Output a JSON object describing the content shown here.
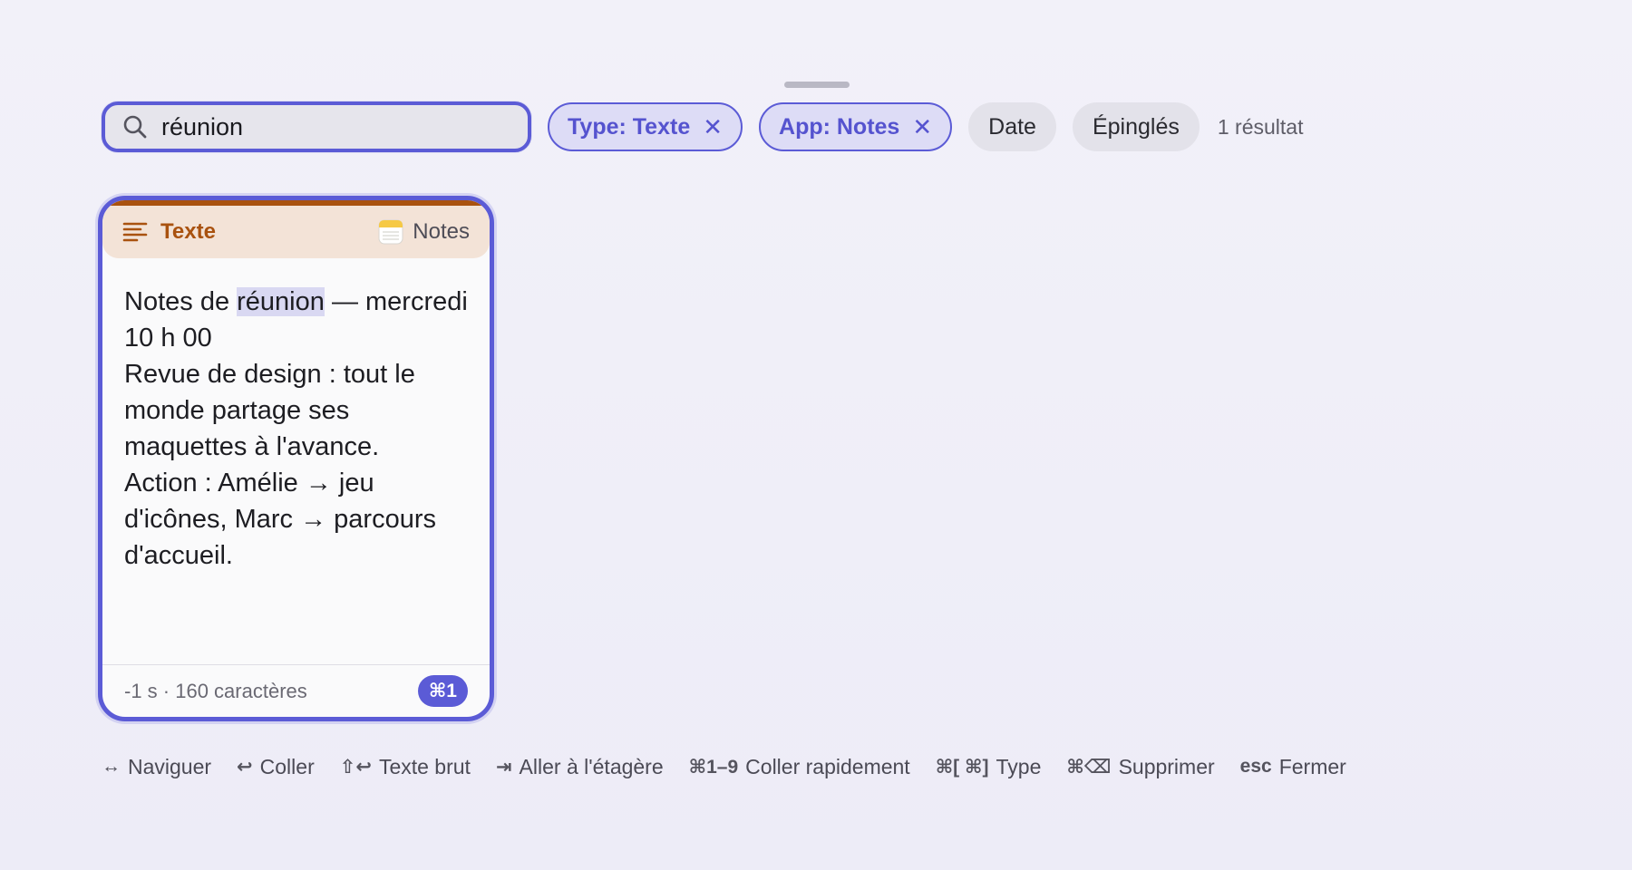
{
  "search": {
    "value": "réunion",
    "icon": "search-icon"
  },
  "filters": {
    "type_chip": "Type: Texte",
    "app_chip": "App: Notes",
    "date_chip": "Date",
    "pinned_chip": "Épinglés",
    "result_count": "1 résultat"
  },
  "card": {
    "type_label": "Texte",
    "app_label": "Notes",
    "body_prefix": "Notes de ",
    "body_match": "réunion",
    "body_rest": " — mercredi 10 h 00\nRevue de design : tout le monde partage ses maquettes à l'avance.\nAction : Amélie → jeu d'icônes, Marc → parcours d'accueil.",
    "meta": "-1 s · 160 caractères",
    "shortcut": "⌘1",
    "accent_color": "#a9520f"
  },
  "hints": [
    {
      "key": "↔",
      "label": "Naviguer"
    },
    {
      "key": "↩",
      "label": "Coller"
    },
    {
      "key": "⇧↩",
      "label": "Texte brut"
    },
    {
      "key": "⇥",
      "label": "Aller à l'étagère"
    },
    {
      "key": "⌘1–9",
      "label": "Coller rapidement"
    },
    {
      "key": "⌘[ ⌘]",
      "label": "Type"
    },
    {
      "key": "⌘⌫",
      "label": "Supprimer"
    },
    {
      "key": "esc",
      "label": "Fermer"
    }
  ],
  "colors": {
    "accent": "#5b5bd6",
    "background": "#efeef8"
  }
}
